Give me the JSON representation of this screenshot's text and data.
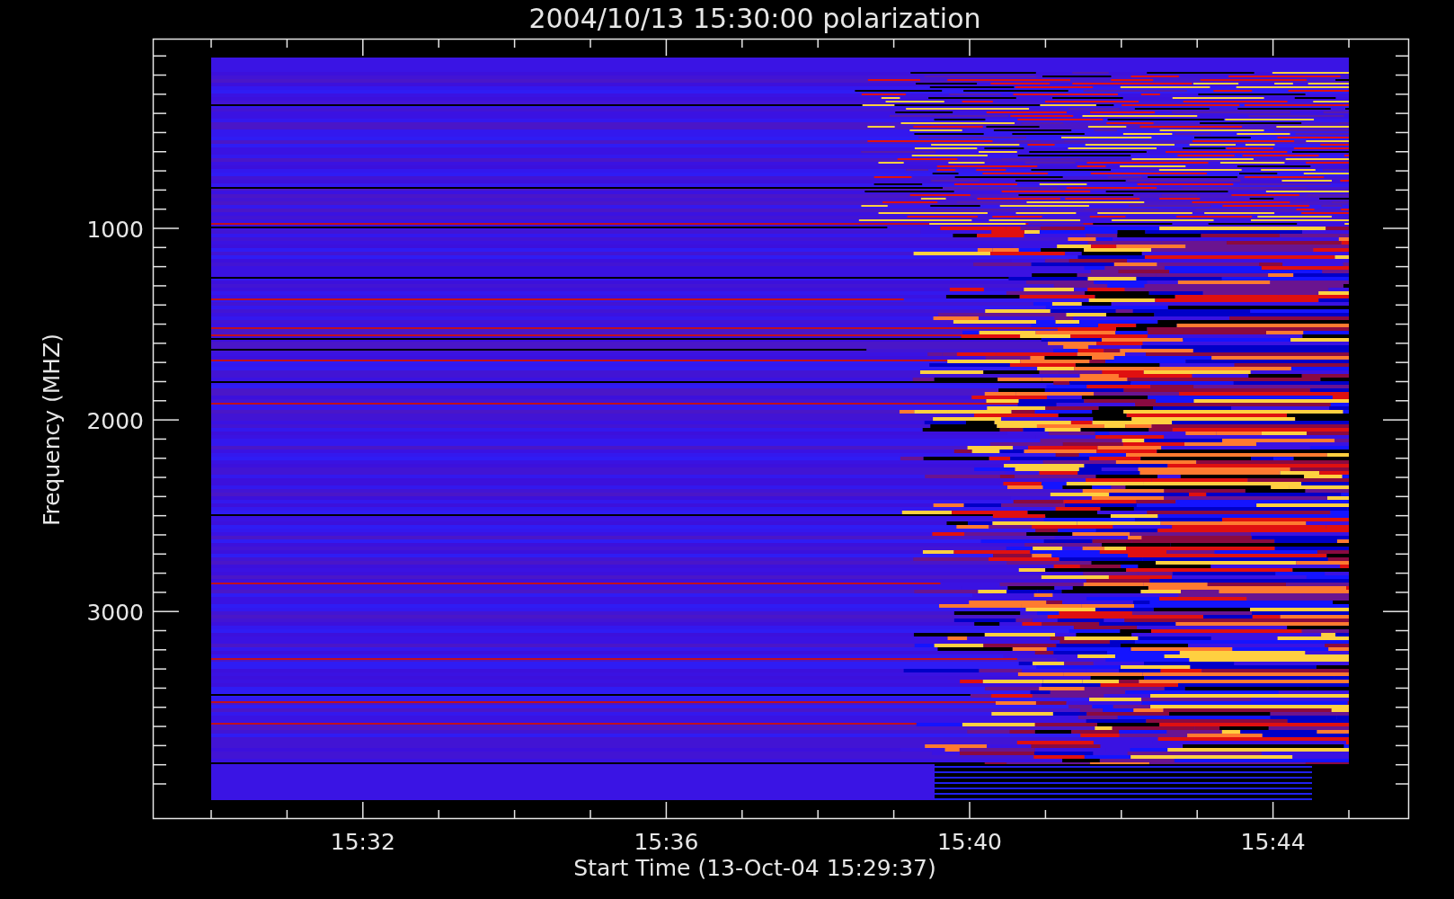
{
  "plot": {
    "title": "2004/10/13 15:30:00 polarization",
    "ylabel": "Frequency (MHZ)",
    "xlabel": "Start Time (13-Oct-04 15:29:37)",
    "xticks": [
      "15:32",
      "15:36",
      "15:40",
      "15:44"
    ],
    "yticks": [
      "1000",
      "2000",
      "3000"
    ]
  }
}
